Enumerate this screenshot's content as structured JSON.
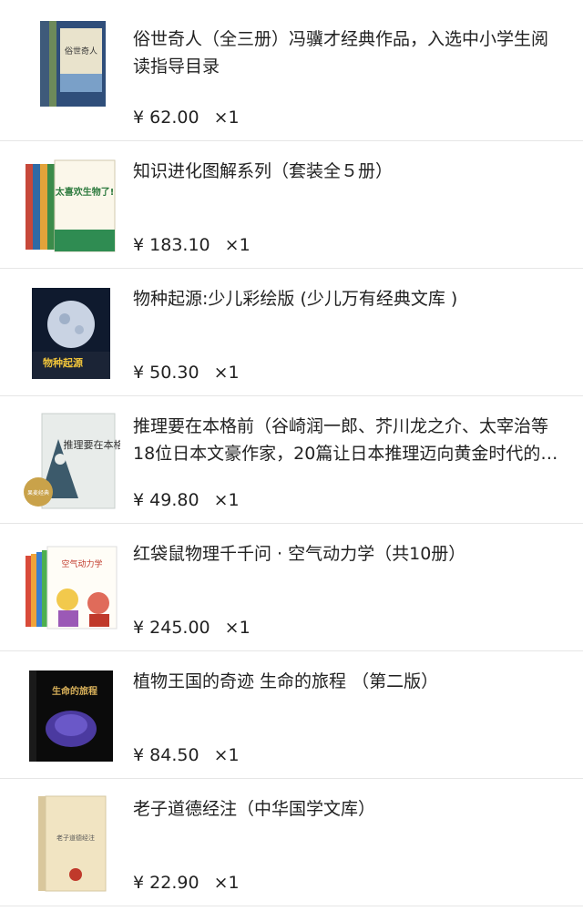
{
  "cart": {
    "currency_symbol": "¥",
    "items": [
      {
        "title": "俗世奇人（全三册）冯骥才经典作品，入选中小学生阅读指导目录",
        "price": "62.00",
        "qty": "×1",
        "cover_text": "俗世奇人"
      },
      {
        "title": "知识进化图解系列（套装全５册）",
        "price": "183.10",
        "qty": "×1",
        "cover_text": "太喜欢生物了!"
      },
      {
        "title": "物种起源:少儿彩绘版 (少儿万有经典文库 )",
        "price": "50.30",
        "qty": "×1",
        "cover_text": "物种起源"
      },
      {
        "title": "推理要在本格前（谷崎润一郎、芥川龙之介、太宰治等18位日本文豪作家，20篇让日本推理迈向黄金时代的名作）",
        "price": "49.80",
        "qty": "×1",
        "cover_text": "推理要在本格前",
        "badge": "果麦经典"
      },
      {
        "title": "红袋鼠物理千千问 · 空气动力学（共10册）",
        "price": "245.00",
        "qty": "×1",
        "cover_text": "空气动力学"
      },
      {
        "title": "植物王国的奇迹 生命的旅程 （第二版）",
        "price": "84.50",
        "qty": "×1",
        "cover_text": "生命的旅程"
      },
      {
        "title": "老子道德经注（中华国学文库）",
        "price": "22.90",
        "qty": "×1",
        "cover_text": "老子道德经注"
      }
    ]
  },
  "colors": {
    "divider": "#e6e6e6",
    "text": "#222222"
  }
}
